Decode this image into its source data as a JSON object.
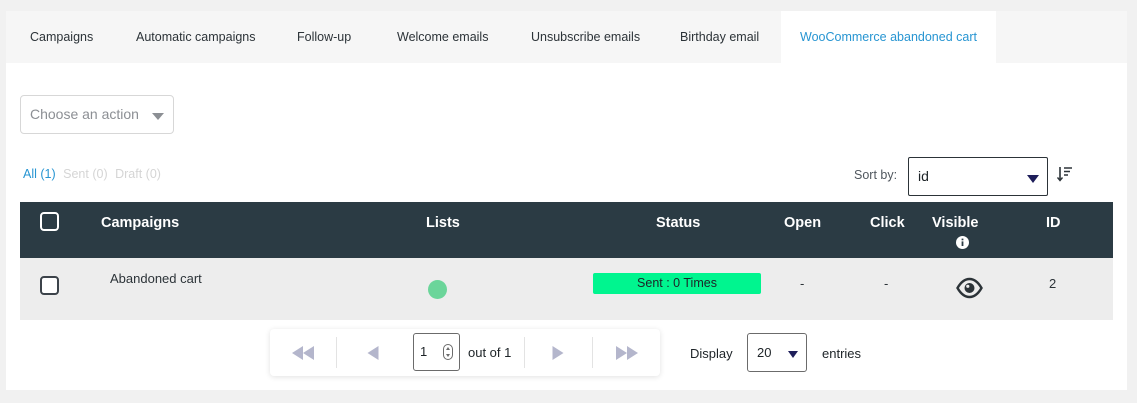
{
  "tabs": [
    {
      "label": "Campaigns"
    },
    {
      "label": "Automatic campaigns"
    },
    {
      "label": "Follow-up"
    },
    {
      "label": "Welcome emails"
    },
    {
      "label": "Unsubscribe emails"
    },
    {
      "label": "Birthday email"
    },
    {
      "label": "WooCommerce abandoned cart",
      "active": true
    }
  ],
  "bulk_action": {
    "placeholder": "Choose an action"
  },
  "filters": {
    "all": "All (1)",
    "sent": "Sent (0)",
    "draft": "Draft (0)"
  },
  "sort": {
    "label": "Sort by:",
    "value": "id"
  },
  "table": {
    "headers": {
      "campaigns": "Campaigns",
      "lists": "Lists",
      "status": "Status",
      "open": "Open",
      "click": "Click",
      "visible": "Visible",
      "id": "ID"
    },
    "rows": [
      {
        "campaign": "Abandoned cart",
        "list_color": "#6bd59a",
        "status": "Sent : 0 Times",
        "status_color": "#00f58f",
        "open": "-",
        "click": "-",
        "visible_icon": "eye-icon",
        "id": "2"
      }
    ]
  },
  "pagination": {
    "current_page": "1",
    "out_of": "out of 1",
    "display_label": "Display",
    "per_page": "20",
    "entries_label": "entries"
  },
  "colors": {
    "accent": "#2795d2",
    "table_header": "#2b3b44"
  }
}
